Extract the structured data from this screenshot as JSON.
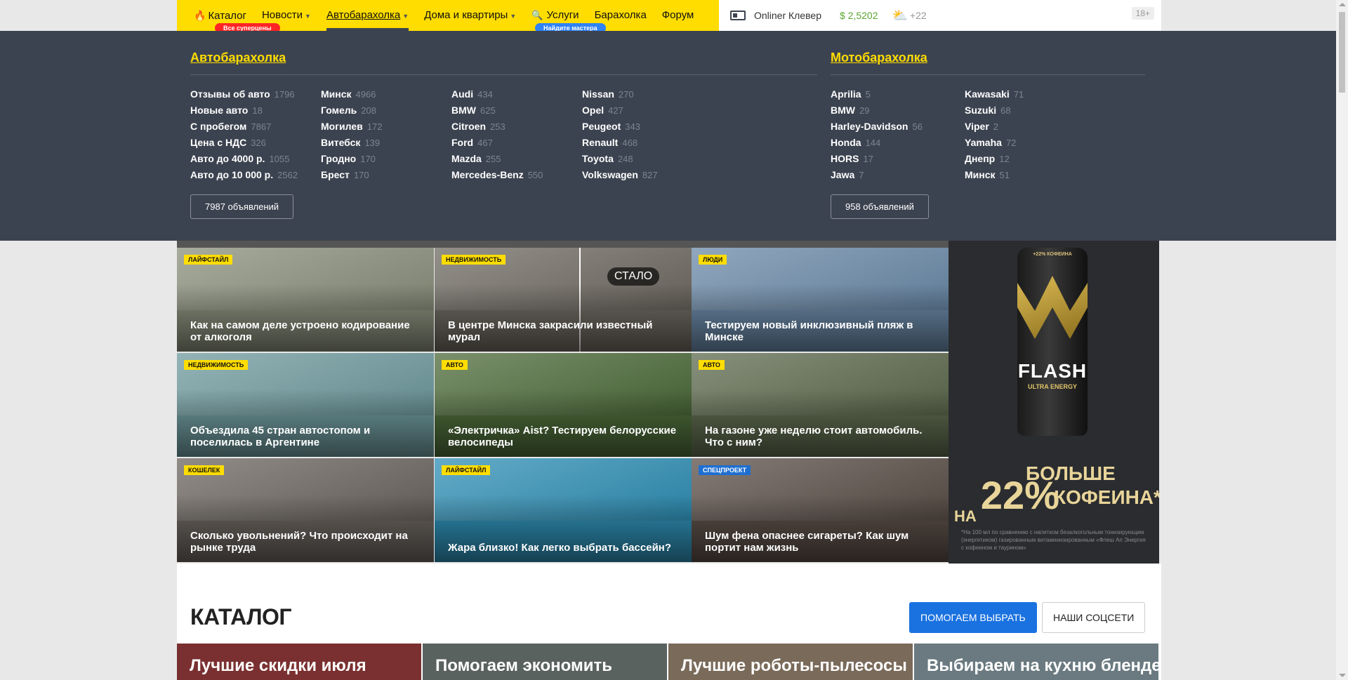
{
  "nav": {
    "items": [
      {
        "label": "Каталог",
        "has_arrow": false
      },
      {
        "label": "Новости",
        "has_arrow": true
      },
      {
        "label": "Автобарахолка",
        "has_arrow": true,
        "active": true
      },
      {
        "label": "Дома и квартиры",
        "has_arrow": true
      },
      {
        "label": "Услуги",
        "has_arrow": false
      },
      {
        "label": "Барахолка",
        "has_arrow": false
      },
      {
        "label": "Форум",
        "has_arrow": false
      }
    ],
    "pill_red": "Все суперцены",
    "pill_blue": "Найдите мастера",
    "clever": "Onliner Клевер",
    "usd": "$ 2,5202",
    "weather": "+22",
    "age": "18+"
  },
  "dropdown": {
    "auto": {
      "title": "Автобарахолка",
      "columns": [
        [
          [
            "Отзывы об авто",
            "1796"
          ],
          [
            "Новые авто",
            "18"
          ],
          [
            "С пробегом",
            "7867"
          ],
          [
            "Цена с НДС",
            "326"
          ],
          [
            "Авто до 4000 р.",
            "1055"
          ],
          [
            "Авто до 10 000 р.",
            "2562"
          ]
        ],
        [
          [
            "Минск",
            "4966"
          ],
          [
            "Гомель",
            "208"
          ],
          [
            "Могилев",
            "172"
          ],
          [
            "Витебск",
            "139"
          ],
          [
            "Гродно",
            "170"
          ],
          [
            "Брест",
            "170"
          ]
        ],
        [
          [
            "Audi",
            "434"
          ],
          [
            "BMW",
            "625"
          ],
          [
            "Citroen",
            "253"
          ],
          [
            "Ford",
            "467"
          ],
          [
            "Mazda",
            "255"
          ],
          [
            "Mercedes-Benz",
            "550"
          ]
        ],
        [
          [
            "Nissan",
            "270"
          ],
          [
            "Opel",
            "427"
          ],
          [
            "Peugeot",
            "343"
          ],
          [
            "Renault",
            "468"
          ],
          [
            "Toyota",
            "248"
          ],
          [
            "Volkswagen",
            "827"
          ]
        ]
      ],
      "button": "7987 объявлений"
    },
    "moto": {
      "title": "Мотобарахолка",
      "columns": [
        [
          [
            "Aprilia",
            "5"
          ],
          [
            "BMW",
            "29"
          ],
          [
            "Harley-Davidson",
            "56"
          ],
          [
            "Honda",
            "144"
          ],
          [
            "HORS",
            "17"
          ],
          [
            "Jawa",
            "7"
          ]
        ],
        [
          [
            "Kawasaki",
            "71"
          ],
          [
            "Suzuki",
            "68"
          ],
          [
            "Viper",
            "2"
          ],
          [
            "Yamaha",
            "72"
          ],
          [
            "Днепр",
            "12"
          ],
          [
            "Минск",
            "51"
          ]
        ]
      ],
      "button": "958 объявлений"
    }
  },
  "news": [
    {
      "tag": "Лайфстайл",
      "title": "Как на самом деле устроено кодирование от алкоголя",
      "bg": "#8a8f7c",
      "tag_color": "yellow"
    },
    {
      "tag": "Недвижимость",
      "title": "В центре Минска закрасили известный мурал",
      "bg": "#6f6a62",
      "tag_color": "yellow",
      "extra": "СТАЛО"
    },
    {
      "tag": "Люди",
      "title": "Тестируем новый инклюзивный пляж в Минске",
      "bg": "#6b8aa8",
      "tag_color": "yellow"
    },
    {
      "tag": "Недвижимость",
      "title": "Объездила 45 стран автостопом и поселилась в Аргентине",
      "bg": "#6f9a9e",
      "tag_color": "yellow"
    },
    {
      "tag": "Авто",
      "title": "«Электричка» Aist? Тестируем белорусские велосипеды",
      "bg": "#4d6b3a",
      "tag_color": "yellow"
    },
    {
      "tag": "Авто",
      "title": "На газоне уже неделю стоит автомобиль. Что с ним?",
      "bg": "#5e6a4e",
      "tag_color": "yellow"
    },
    {
      "tag": "Кошелек",
      "title": "Сколько увольнений? Что происходит на рынке труда",
      "bg": "#6b6560",
      "tag_color": "yellow"
    },
    {
      "tag": "Лайфстайл",
      "title": "Жара близко! Как легко выбрать бассейн?",
      "bg": "#2f8fb5",
      "tag_color": "yellow"
    },
    {
      "tag": "Спецпроект",
      "title": "Шум фена опаснее сигареты? Как шум портит нам жизнь",
      "bg": "#5b4f48",
      "tag_color": "blue"
    }
  ],
  "ad": {
    "can_top": "+22% КОФЕИНА",
    "brand": "FLASH",
    "sub": "ULTRA ENERGY",
    "line1": "22% БОЛЬШЕ",
    "line2": "НА 22% КОФЕИНА*",
    "big_a": "БОЛЬШЕ",
    "big_pre": "НА",
    "big_num": "22%",
    "big_b": "КОФЕИНА*",
    "note": "*На 100 мл по сравнению с напитком безалкогольным тонизирующим (энергетиком) газированным витаминизированным «Флеш Ап Энергия с кофеином и таурином»"
  },
  "catalog": {
    "heading": "КАТАЛОГ",
    "btn_help": "ПОМОГАЕМ ВЫБРАТЬ",
    "btn_social": "НАШИ СОЦСЕТИ",
    "cards": [
      {
        "label": "Лучшие скидки июля",
        "bg": "#7a3030"
      },
      {
        "label": "Помогаем экономить",
        "bg": "#5a6260"
      },
      {
        "label": "Лучшие роботы-пылесосы",
        "bg": "#7a6a5a"
      },
      {
        "label": "Выбираем на кухню блендер",
        "bg": "#6a7a80"
      }
    ]
  }
}
